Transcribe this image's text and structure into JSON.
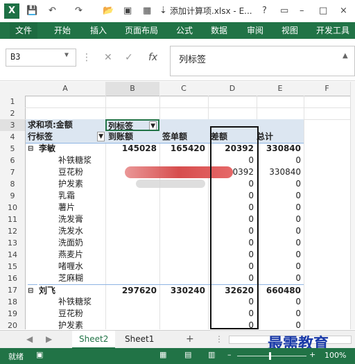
{
  "title_bar": {
    "title": "添加计算项.xlsx - E...",
    "help": "?",
    "minimize": "–",
    "restore": "□",
    "close": "×"
  },
  "ribbon": {
    "tabs": [
      "文件",
      "开始",
      "插入",
      "页面布局",
      "公式",
      "数据",
      "审阅",
      "视图",
      "开发工具"
    ]
  },
  "formula_bar": {
    "name_box": "B3",
    "content": "列标签"
  },
  "columns": [
    "A",
    "B",
    "C",
    "D",
    "E",
    "F"
  ],
  "rows": [
    1,
    2,
    3,
    4,
    5,
    6,
    7,
    8,
    9,
    10,
    11,
    12,
    13,
    14,
    15,
    16,
    17,
    18,
    19,
    20
  ],
  "pivot": {
    "sum_label": "求和项:金额",
    "col_label": "列标签",
    "row_label": "行标签",
    "col_heads": [
      "到账额",
      "签单额",
      "差额",
      "总计"
    ],
    "groups": [
      {
        "name": "李敏",
        "values": [
          "145028",
          "165420",
          "20392",
          "330840"
        ]
      },
      {
        "name": "刘飞",
        "values": [
          "297620",
          "330240",
          "32620",
          "660480"
        ]
      }
    ],
    "items": [
      {
        "name": "补铁糖浆",
        "d": "0",
        "e": "0"
      },
      {
        "name": "豆花粉",
        "d": "0392",
        "e": "330840"
      },
      {
        "name": "护发素",
        "d": "0",
        "e": "0"
      },
      {
        "name": "乳霜",
        "d": "0",
        "e": "0"
      },
      {
        "name": "薯片",
        "d": "0",
        "e": "0"
      },
      {
        "name": "洗发膏",
        "d": "0",
        "e": "0"
      },
      {
        "name": "洗发水",
        "d": "0",
        "e": "0"
      },
      {
        "name": "洗面奶",
        "d": "0",
        "e": "0"
      },
      {
        "name": "燕麦片",
        "d": "0",
        "e": "0"
      },
      {
        "name": "啫喱水",
        "d": "0",
        "e": "0"
      },
      {
        "name": "芝麻糊",
        "d": "0",
        "e": "0"
      }
    ],
    "items2": [
      {
        "name": "补铁糖浆",
        "d": "0",
        "e": "0"
      },
      {
        "name": "豆花粉",
        "d": "0",
        "e": "0"
      },
      {
        "name": "护发素",
        "d": "0",
        "e": "0"
      }
    ]
  },
  "sheets": {
    "tabs": [
      "Sheet2",
      "Sheet1"
    ],
    "add": "+"
  },
  "status": {
    "left": "就绪",
    "zoom": "100%"
  },
  "watermark": "最需教育",
  "colors": {
    "excel_green": "#217346",
    "pivot_header": "#dce6f1"
  }
}
